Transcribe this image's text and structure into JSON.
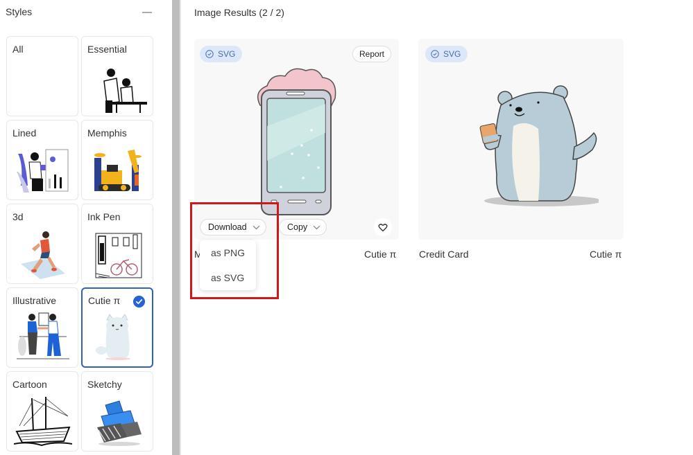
{
  "sidebar": {
    "title": "Styles",
    "collapse_icon": "minus-icon",
    "styles": [
      {
        "label": "All",
        "selected": false
      },
      {
        "label": "Essential",
        "selected": false
      },
      {
        "label": "Lined",
        "selected": false
      },
      {
        "label": "Memphis",
        "selected": false
      },
      {
        "label": "3d",
        "selected": false
      },
      {
        "label": "Ink Pen",
        "selected": false
      },
      {
        "label": "Illustrative",
        "selected": false
      },
      {
        "label": "Cutie π",
        "selected": true
      },
      {
        "label": "Cartoon",
        "selected": false
      },
      {
        "label": "Sketchy",
        "selected": false
      }
    ]
  },
  "main": {
    "title": "Image Results (2 / 2)",
    "results": [
      {
        "badge": "SVG",
        "report_label": "Report",
        "title": "Mobile Phone",
        "style": "Cutie π",
        "image": "pink-cloud-phone-illustration",
        "download_label": "Download",
        "copy_label": "Copy"
      },
      {
        "badge": "SVG",
        "title": "Credit Card",
        "style": "Cutie π",
        "image": "polar-bear-holding-card-illustration"
      }
    ],
    "download_menu": {
      "items": [
        "as PNG",
        "as SVG"
      ]
    }
  },
  "colors": {
    "accent": "#2563d6",
    "selected_border": "#2f5fbf",
    "badge_bg": "#dce8f9",
    "badge_text": "#4a6aa8",
    "highlight": "#d01818"
  }
}
